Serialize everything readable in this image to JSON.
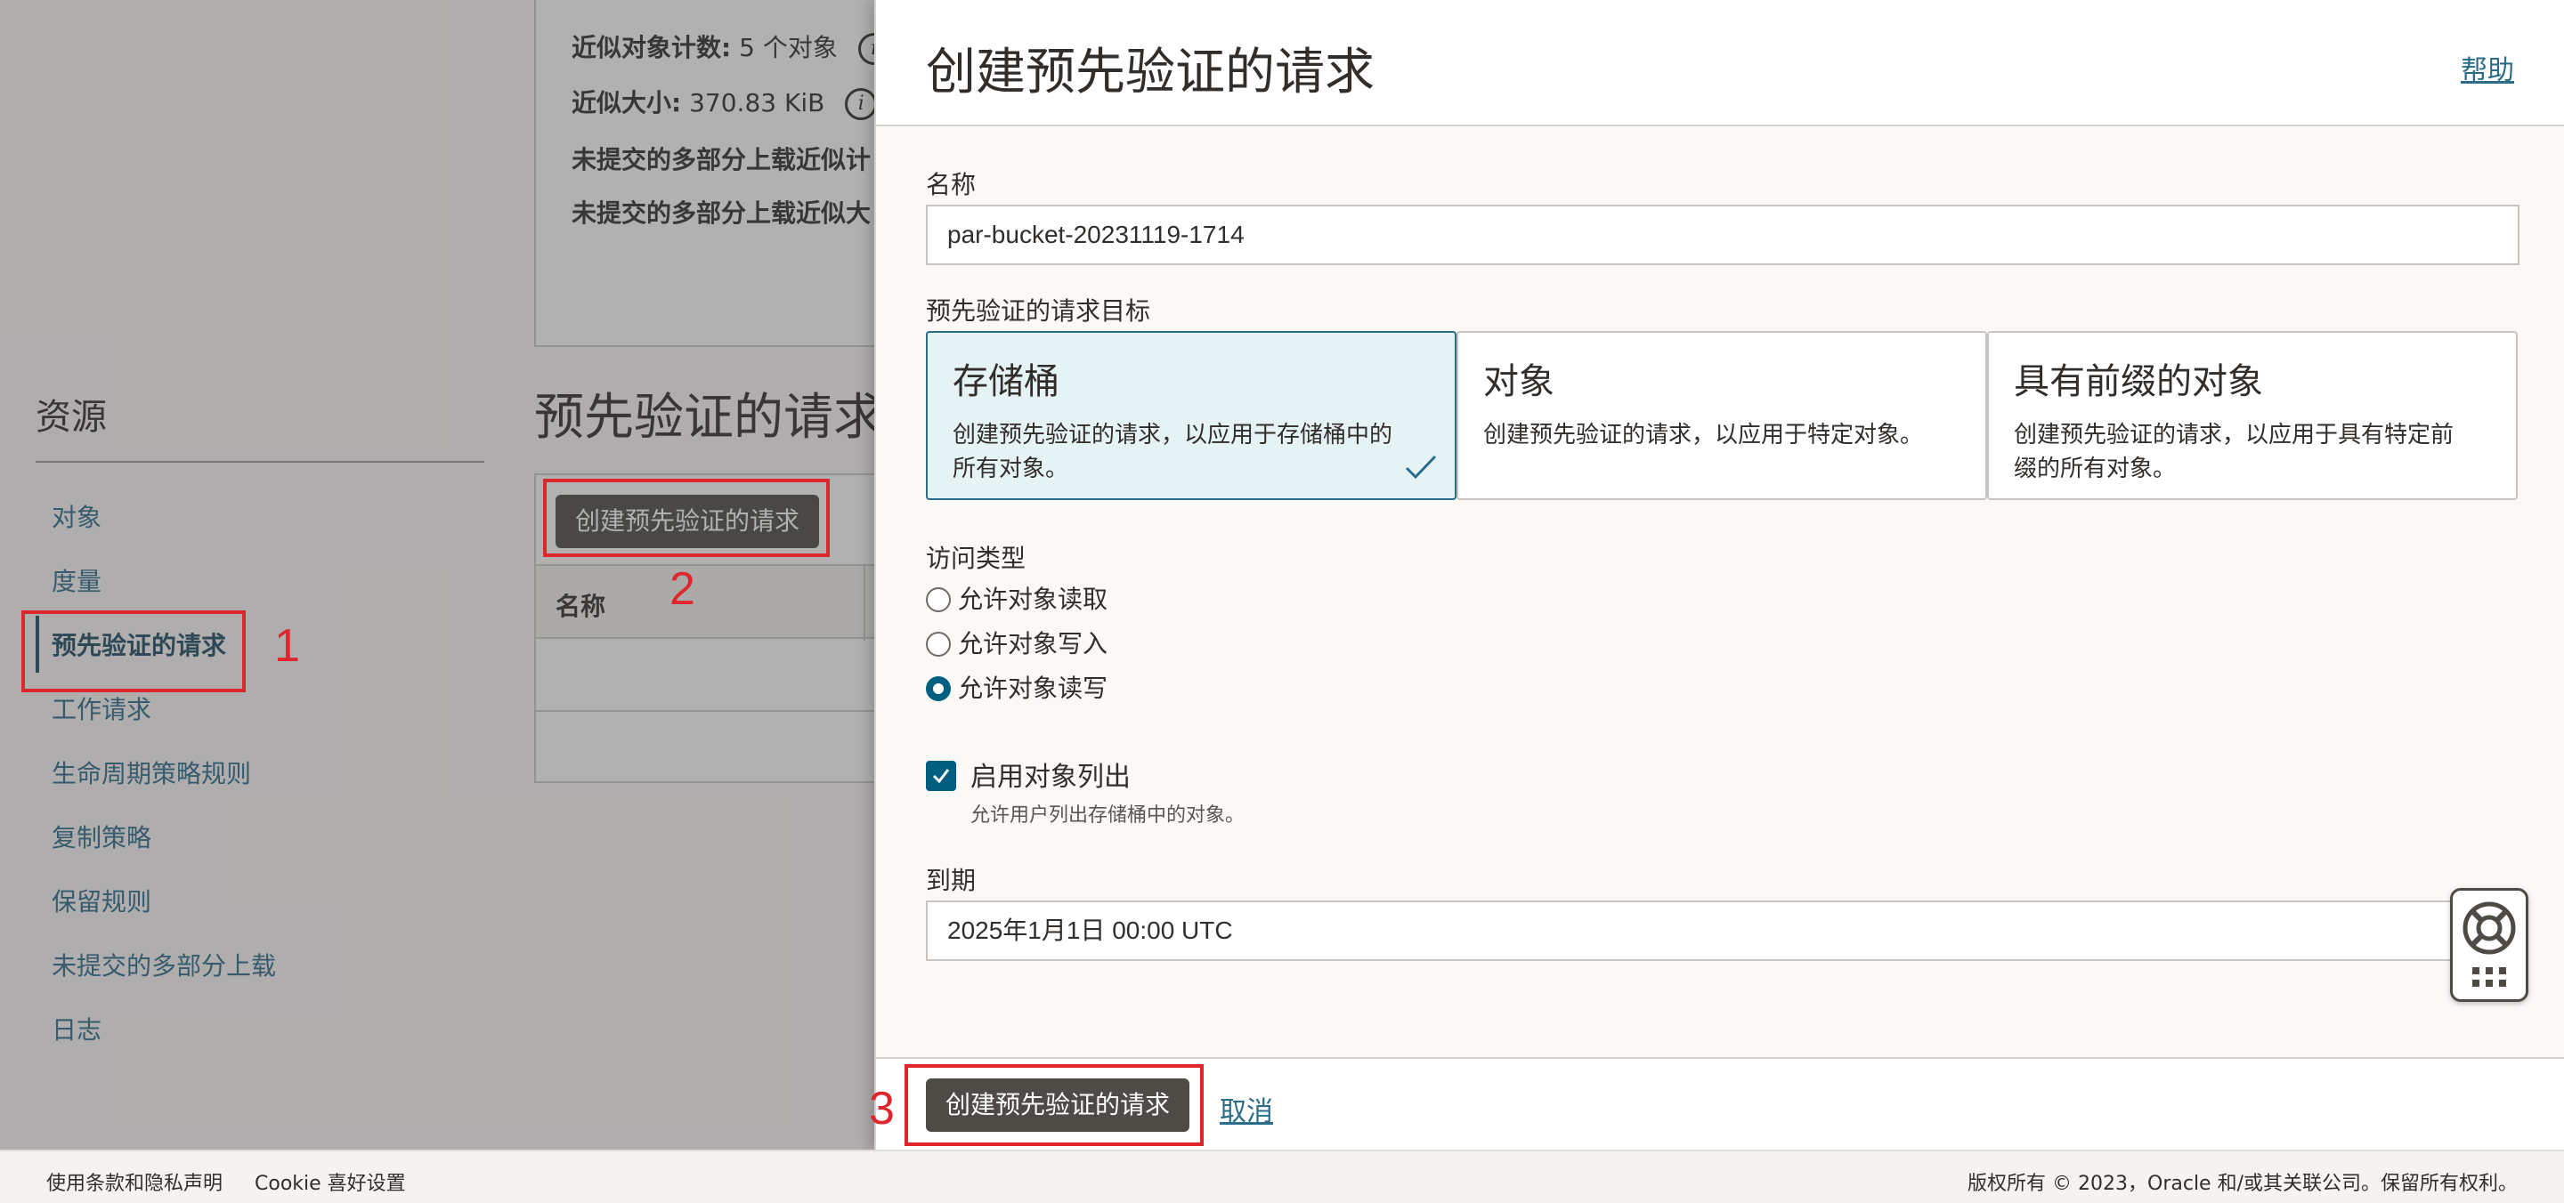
{
  "background_page": {
    "details": {
      "approx_count_label": "近似对象计数:",
      "approx_count_value": "5 个对象",
      "approx_size_label": "近似大小:",
      "approx_size_value": "370.83 KiB",
      "uncommitted_count_label": "未提交的多部分上载近似计",
      "uncommitted_size_label": "未提交的多部分上载近似大"
    },
    "resources": {
      "title": "资源",
      "items": [
        {
          "label": "对象",
          "active": false
        },
        {
          "label": "度量",
          "active": false
        },
        {
          "label": "预先验证的请求",
          "active": true
        },
        {
          "label": "工作请求",
          "active": false
        },
        {
          "label": "生命周期策略规则",
          "active": false
        },
        {
          "label": "复制策略",
          "active": false
        },
        {
          "label": "保留规则",
          "active": false
        },
        {
          "label": "未提交的多部分上载",
          "active": false
        },
        {
          "label": "日志",
          "active": false
        }
      ]
    },
    "par_section": {
      "heading": "预先验证的请求",
      "create_button": "创建预先验证的请求",
      "name_column": "名称"
    }
  },
  "annotations": {
    "step1": "1",
    "step2": "2",
    "step3": "3",
    "color": "#e0262d"
  },
  "drawer": {
    "title": "创建预先验证的请求",
    "help_link": "帮助",
    "name_label": "名称",
    "name_value": "par-bucket-20231119-1714",
    "target_label": "预先验证的请求目标",
    "targets": [
      {
        "title": "存储桶",
        "desc": "创建预先验证的请求，以应用于存储桶中的所有对象。",
        "selected": true
      },
      {
        "title": "对象",
        "desc": "创建预先验证的请求，以应用于特定对象。",
        "selected": false
      },
      {
        "title": "具有前缀的对象",
        "desc": "创建预先验证的请求，以应用于具有特定前缀的所有对象。",
        "selected": false
      }
    ],
    "access_type_label": "访问类型",
    "access_options": [
      {
        "label": "允许对象读取",
        "checked": false
      },
      {
        "label": "允许对象写入",
        "checked": false
      },
      {
        "label": "允许对象读写",
        "checked": true
      }
    ],
    "enable_listing_label": "启用对象列出",
    "enable_listing_checked": true,
    "enable_listing_hint": "允许用户列出存储桶中的对象。",
    "expiration_label": "到期",
    "expiration_value": "2025年1月1日 00:00 UTC",
    "submit_button": "创建预先验证的请求",
    "cancel_link": "取消",
    "accent_color": "#005e7e"
  },
  "footer": {
    "terms": "使用条款和隐私声明",
    "cookie": "Cookie 喜好设置",
    "copyright": "版权所有 © 2023，Oracle 和/或其关联公司。保留所有权利。"
  }
}
